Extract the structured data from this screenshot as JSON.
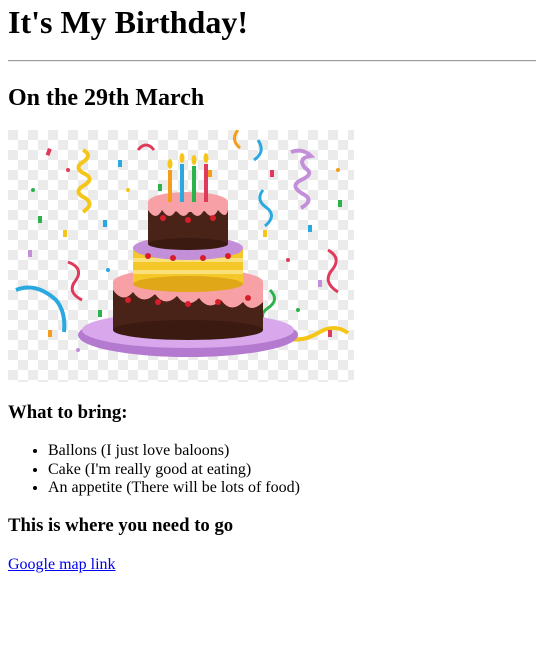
{
  "page": {
    "title": "It's My Birthday!",
    "date_heading": "On the 29th March",
    "bring_heading": "What to bring:",
    "bring_items": [
      "Ballons (I just love baloons)",
      "Cake (I'm really good at eating)",
      "An appetite (There will be lots of food)"
    ],
    "go_heading": "This is where you need to go",
    "map_link": "Google map link"
  },
  "image": {
    "subject": "birthday-cake-with-candles-and-confetti",
    "colors": {
      "chocolate": "#4a2318",
      "pink_frosting": "#f7a1a6",
      "yellow_layer": "#f5c82a",
      "purple_plate": "#c38fd9",
      "checker_light": "#ebebeb"
    }
  },
  "colors": {
    "link": "#0000ee",
    "rule": "#9a9a9a",
    "text": "#000000"
  }
}
